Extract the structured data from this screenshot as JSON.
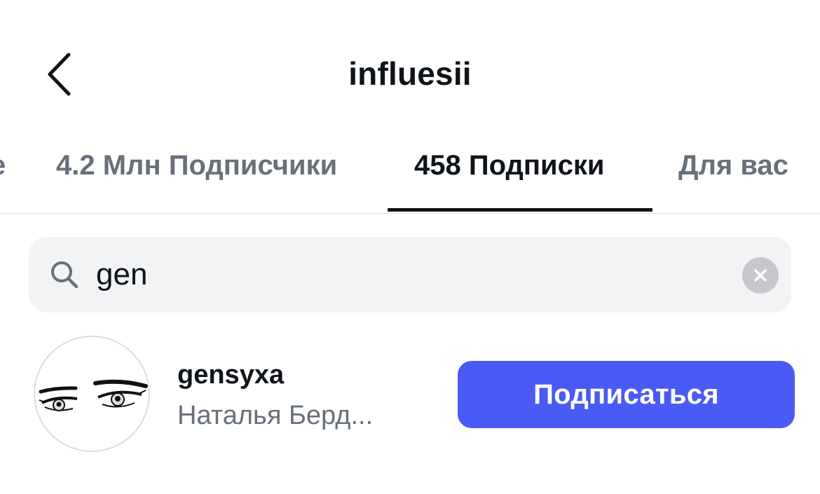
{
  "header": {
    "title": "influesii",
    "back_icon": "chevron-left-icon"
  },
  "tabs": [
    {
      "label": "е",
      "active": false
    },
    {
      "label": "4.2 Млн Подписчики",
      "active": false
    },
    {
      "label": "458 Подписки",
      "active": true
    },
    {
      "label": "Для вас",
      "active": false
    }
  ],
  "search": {
    "value": "gen",
    "icon": "search-icon",
    "clear_icon": "clear-icon"
  },
  "results": [
    {
      "username": "gensyxa",
      "full_name": "Наталья Берд...",
      "button_label": "Подписаться",
      "avatar": "anime-eyes-avatar"
    }
  ],
  "colors": {
    "accent": "#4a5af5",
    "text_primary": "#0f1419",
    "text_secondary": "#68707a",
    "search_bg": "#f2f3f5"
  }
}
